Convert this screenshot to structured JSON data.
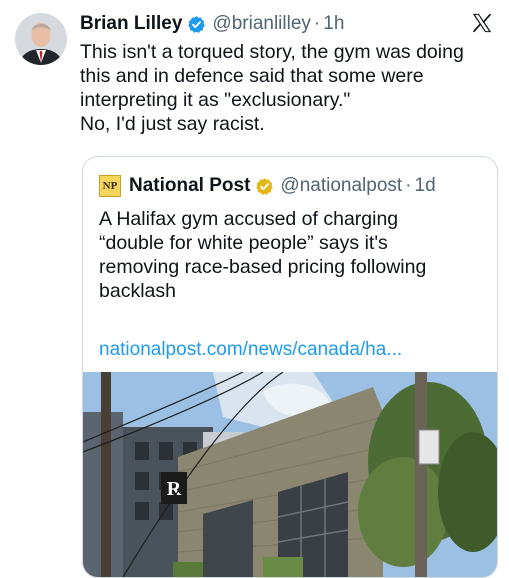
{
  "author": {
    "name": "Brian Lilley",
    "handle": "@brianlilley",
    "separator": "·",
    "time": "1h"
  },
  "tweet": {
    "lines": [
      "This isn't a torqued story, the gym was doing",
      "this and in defence said that some were",
      "interpreting it as \"exclusionary.\"",
      "No, I'd just say racist."
    ]
  },
  "quoted": {
    "logo_text": "NP",
    "name": "National Post",
    "handle": "@nationalpost",
    "separator": "·",
    "time": "1d",
    "lines": [
      "A Halifax gym accused of charging",
      "“double for white people” says it's",
      "removing race-based pricing following",
      "backlash"
    ],
    "link": "nationalpost.com/news/canada/ha...",
    "sign_letter": "R"
  },
  "icons": {
    "verified": "verified-badge-icon",
    "gold_verified": "gold-verified-badge-icon",
    "x_logo": "x-logo-icon"
  },
  "colors": {
    "verified_blue": "#1d9bf0",
    "gold_badge": "#e2b719",
    "link_blue": "#1d9bf0",
    "muted_text": "#536471"
  }
}
